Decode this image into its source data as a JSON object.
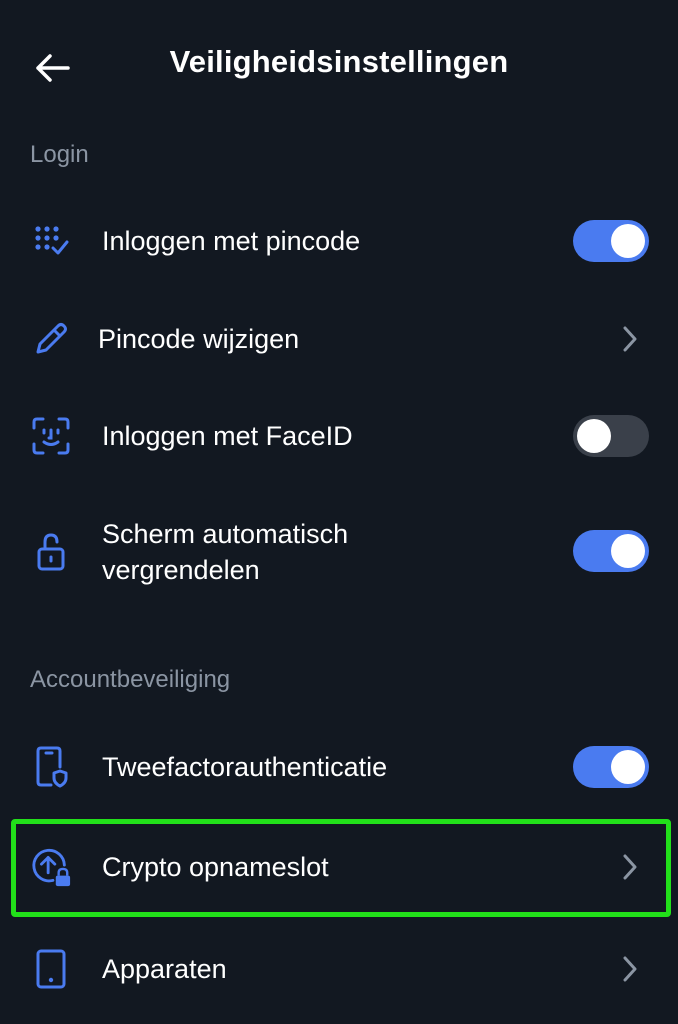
{
  "header": {
    "title": "Veiligheidsinstellingen",
    "back_icon": "arrow-left-icon"
  },
  "sections": {
    "login": {
      "label": "Login",
      "items": [
        {
          "label": "Inloggen met pincode",
          "icon": "pincode-check-icon",
          "control": "toggle",
          "enabled": true
        },
        {
          "label": "Pincode wijzigen",
          "icon": "pencil-icon",
          "control": "chevron"
        },
        {
          "label": "Inloggen met FaceID",
          "icon": "faceid-icon",
          "control": "toggle",
          "enabled": false
        },
        {
          "label_line1": "Scherm automatisch",
          "label_line2": "vergrendelen",
          "icon": "unlock-icon",
          "control": "toggle",
          "enabled": true
        }
      ]
    },
    "account": {
      "label": "Accountbeveiliging",
      "items": [
        {
          "label": "Tweefactorauthenticatie",
          "icon": "phone-shield-icon",
          "control": "toggle",
          "enabled": true
        },
        {
          "label": "Crypto opnameslot",
          "icon": "upload-lock-icon",
          "control": "chevron",
          "highlighted": true
        },
        {
          "label": "Apparaten",
          "icon": "device-icon",
          "control": "chevron"
        }
      ]
    }
  },
  "colors": {
    "background": "#121821",
    "accent": "#4a7bf0",
    "muted_text": "#8b95a3",
    "chevron": "#8b95a3",
    "toggle_off": "#3a404a",
    "highlight": "#22e01a"
  }
}
